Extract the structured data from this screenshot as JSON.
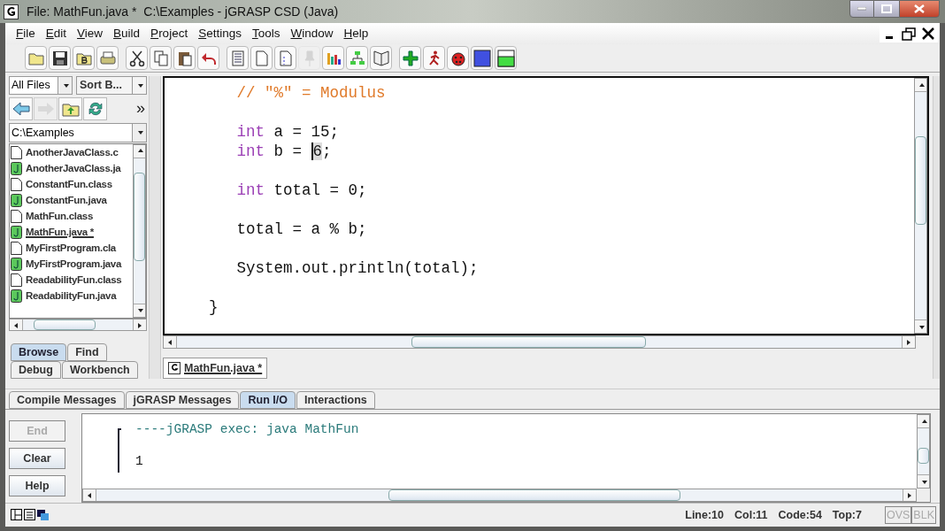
{
  "window": {
    "title": "File: MathFun.java *  C:\\Examples - jGRASP CSD (Java)"
  },
  "menu": [
    "File",
    "Edit",
    "View",
    "Build",
    "Project",
    "Settings",
    "Tools",
    "Window",
    "Help"
  ],
  "toolbar": [
    {
      "disabled": false
    },
    {
      "disabled": false
    },
    {
      "disabled": false
    },
    {
      "disabled": false
    },
    {
      "disabled": false
    },
    {
      "disabled": false
    },
    {
      "disabled": false
    },
    {
      "disabled": false
    },
    {
      "disabled": false
    },
    {
      "disabled": false
    },
    {
      "disabled": false
    },
    {
      "disabled": true
    },
    {
      "disabled": false
    },
    {
      "disabled": false
    },
    {
      "disabled": false
    },
    {
      "disabled": false
    },
    {
      "disabled": false
    },
    {
      "disabled": false
    },
    {
      "disabled": false
    },
    {
      "disabled": false
    }
  ],
  "browser": {
    "filter": "All Files",
    "sort": "Sort B...",
    "nav": [
      {
        "disabled": false
      },
      {
        "disabled": true
      },
      {
        "disabled": false
      },
      {
        "disabled": false
      }
    ],
    "more": "»",
    "path": "C:\\Examples",
    "files": [
      {
        "name": "AnotherJavaClass.c",
        "kind": "class",
        "selected": false
      },
      {
        "name": "AnotherJavaClass.ja",
        "kind": "java",
        "selected": false
      },
      {
        "name": "ConstantFun.class",
        "kind": "class",
        "selected": false
      },
      {
        "name": "ConstantFun.java",
        "kind": "java",
        "selected": false
      },
      {
        "name": "MathFun.class",
        "kind": "class",
        "selected": false
      },
      {
        "name": "MathFun.java *",
        "kind": "java",
        "selected": true
      },
      {
        "name": "MyFirstProgram.cla",
        "kind": "class",
        "selected": false
      },
      {
        "name": "MyFirstProgram.java",
        "kind": "java",
        "selected": false
      },
      {
        "name": "ReadabilityFun.class",
        "kind": "class",
        "selected": false
      },
      {
        "name": "ReadabilityFun.java",
        "kind": "java",
        "selected": false
      }
    ],
    "tabs_top": [
      {
        "label": "Browse",
        "selected": true
      },
      {
        "label": "Find",
        "selected": false
      }
    ],
    "tabs_bottom": [
      {
        "label": "Debug",
        "selected": false
      },
      {
        "label": "Workbench",
        "selected": false
      }
    ]
  },
  "editor": {
    "lines": [
      {
        "kind": "code",
        "segments": [
          {
            "kind": "comment",
            "text": "   // \"%\" = Modulus"
          }
        ]
      },
      {
        "kind": "blank"
      },
      {
        "kind": "code",
        "segments": [
          {
            "kind": "keyword",
            "text": "   int"
          },
          {
            "kind": "plain",
            "text": " a = 15;"
          }
        ]
      },
      {
        "kind": "code",
        "segments": [
          {
            "kind": "keyword",
            "text": "   int"
          },
          {
            "kind": "plain",
            "text": " b = "
          },
          {
            "kind": "plain",
            "text": "6",
            "cursor": true
          },
          {
            "kind": "plain",
            "text": ";"
          }
        ]
      },
      {
        "kind": "blank"
      },
      {
        "kind": "code",
        "segments": [
          {
            "kind": "keyword",
            "text": "   int"
          },
          {
            "kind": "plain",
            "text": " total = 0;"
          }
        ]
      },
      {
        "kind": "blank"
      },
      {
        "kind": "code",
        "segments": [
          {
            "kind": "plain",
            "text": "   total = a % b;"
          }
        ]
      },
      {
        "kind": "blank"
      },
      {
        "kind": "code",
        "segments": [
          {
            "kind": "plain",
            "text": "   System.out.println(total);"
          }
        ]
      },
      {
        "kind": "blank"
      },
      {
        "kind": "code",
        "segments": [
          {
            "kind": "plain",
            "text": "}"
          }
        ]
      }
    ],
    "tab": {
      "label": "MathFun.java *",
      "selected": true
    }
  },
  "messages": {
    "tabs": [
      {
        "label": "Compile Messages",
        "selected": false
      },
      {
        "label": "jGRASP Messages",
        "selected": false
      },
      {
        "label": "Run I/O",
        "selected": true
      },
      {
        "label": "Interactions",
        "selected": false
      }
    ],
    "buttons": [
      {
        "label": "End",
        "disabled": true
      },
      {
        "label": "Clear",
        "disabled": false
      },
      {
        "label": "Help",
        "disabled": false
      }
    ],
    "output": [
      {
        "kind": "header",
        "text": "----jGRASP exec: java MathFun"
      },
      {
        "kind": "blank"
      },
      {
        "kind": "result",
        "text": "1"
      }
    ]
  },
  "status_bar": {
    "fields": [
      "Line:10",
      "Col:11",
      "Code:54",
      "Top:7"
    ],
    "flags": [
      {
        "label": "OVS",
        "on": false
      },
      {
        "label": "BLK",
        "on": false
      }
    ]
  }
}
